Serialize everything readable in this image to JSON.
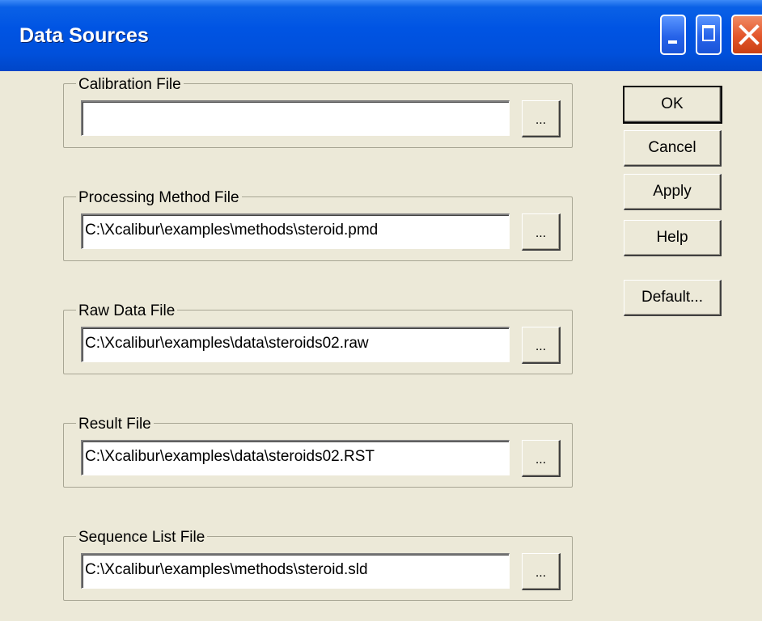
{
  "window": {
    "title": "Data Sources",
    "controls": {
      "minimize_icon": "minimize-icon",
      "maximize_icon": "maximize-icon",
      "close_icon": "close-icon"
    }
  },
  "groups": [
    {
      "label": "Calibration File",
      "value": "",
      "browse_label": "..."
    },
    {
      "label": "Processing Method File",
      "value": "C:\\Xcalibur\\examples\\methods\\steroid.pmd",
      "browse_label": "..."
    },
    {
      "label": "Raw Data File",
      "value": "C:\\Xcalibur\\examples\\data\\steroids02.raw",
      "browse_label": "..."
    },
    {
      "label": "Result File",
      "value": "C:\\Xcalibur\\examples\\data\\steroids02.RST",
      "browse_label": "..."
    },
    {
      "label": "Sequence List File",
      "value": "C:\\Xcalibur\\examples\\methods\\steroid.sld",
      "browse_label": "..."
    }
  ],
  "buttons": {
    "ok": "OK",
    "cancel": "Cancel",
    "apply": "Apply",
    "help": "Help",
    "default": "Default..."
  },
  "colors": {
    "titlebar": "#0054e3",
    "dialog_bg": "#ece9d8",
    "close_button": "#e3552a"
  }
}
